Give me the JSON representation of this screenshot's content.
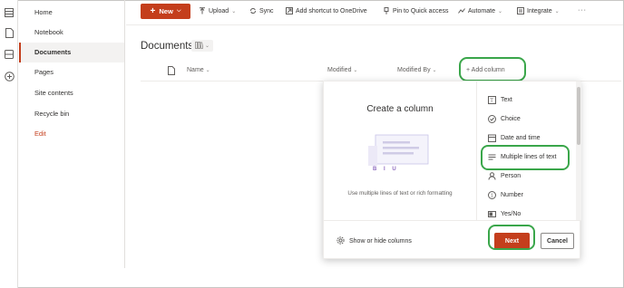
{
  "nav": {
    "items": [
      {
        "label": "Home",
        "active": false
      },
      {
        "label": "Notebook",
        "active": false
      },
      {
        "label": "Documents",
        "active": true
      },
      {
        "label": "Pages",
        "active": false
      },
      {
        "label": "Site contents",
        "active": false
      },
      {
        "label": "Recycle bin",
        "active": false
      }
    ],
    "edit_label": "Edit"
  },
  "rail": {
    "icons": [
      "grid-icon",
      "document-icon",
      "database-icon",
      "add-circle-icon"
    ]
  },
  "toolbar": {
    "new_label": "New",
    "upload_label": "Upload",
    "sync_label": "Sync",
    "shortcut_label": "Add shortcut to OneDrive",
    "pin_label": "Pin to Quick access",
    "automate_label": "Automate",
    "integrate_label": "Integrate",
    "more_label": "···"
  },
  "library": {
    "title": "Documents"
  },
  "columns": {
    "name": "Name",
    "modified": "Modified",
    "modified_by": "Modified By",
    "add_column": "+ Add column"
  },
  "panel": {
    "title": "Create a column",
    "description": "Use multiple lines of text or rich formatting",
    "illustration_glyphs": "B I U",
    "options": [
      {
        "label": "Text",
        "icon": "text-icon"
      },
      {
        "label": "Choice",
        "icon": "choice-icon"
      },
      {
        "label": "Date and time",
        "icon": "calendar-icon"
      },
      {
        "label": "Multiple lines of text",
        "icon": "multiline-icon"
      },
      {
        "label": "Person",
        "icon": "person-icon"
      },
      {
        "label": "Number",
        "icon": "number-icon"
      },
      {
        "label": "Yes/No",
        "icon": "toggle-icon"
      }
    ],
    "show_hide_label": "Show or hide columns",
    "next_label": "Next",
    "cancel_label": "Cancel"
  },
  "colors": {
    "accent": "#c43e1c",
    "highlight": "#3aa64a"
  }
}
